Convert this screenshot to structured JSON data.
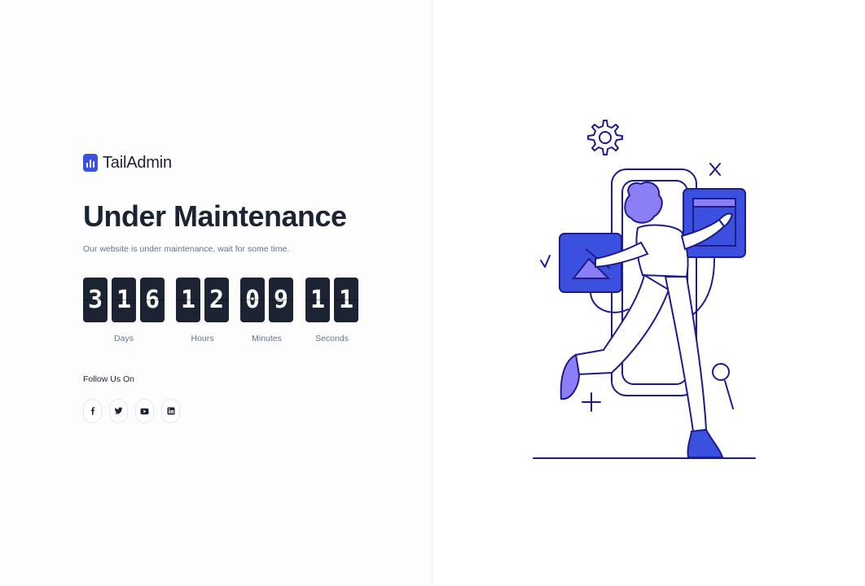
{
  "brand": {
    "name": "TailAdmin",
    "logo_icon": "tailadmin-logo-icon"
  },
  "page": {
    "title": "Under Maintenance",
    "subtitle": "Our website is under maintenance, wait for some time."
  },
  "countdown": {
    "days": {
      "digits": [
        "3",
        "1",
        "6"
      ],
      "label": "Days"
    },
    "hours": {
      "digits": [
        "1",
        "2"
      ],
      "label": "Hours"
    },
    "minutes": {
      "digits": [
        "0",
        "9"
      ],
      "label": "Minutes"
    },
    "seconds": {
      "digits": [
        "1",
        "1"
      ],
      "label": "Seconds"
    }
  },
  "social": {
    "heading": "Follow Us On",
    "links": [
      {
        "icon": "facebook-icon"
      },
      {
        "icon": "twitter-icon"
      },
      {
        "icon": "youtube-icon"
      },
      {
        "icon": "linkedin-icon"
      }
    ]
  },
  "illustration": {
    "icon": "maintenance-person-illustration"
  },
  "colors": {
    "primary": "#3c50e0",
    "dark": "#1c2434",
    "muted": "#64748b",
    "illustration_stroke": "#1e1b8a",
    "illustration_fill": "#8b7ff5"
  }
}
